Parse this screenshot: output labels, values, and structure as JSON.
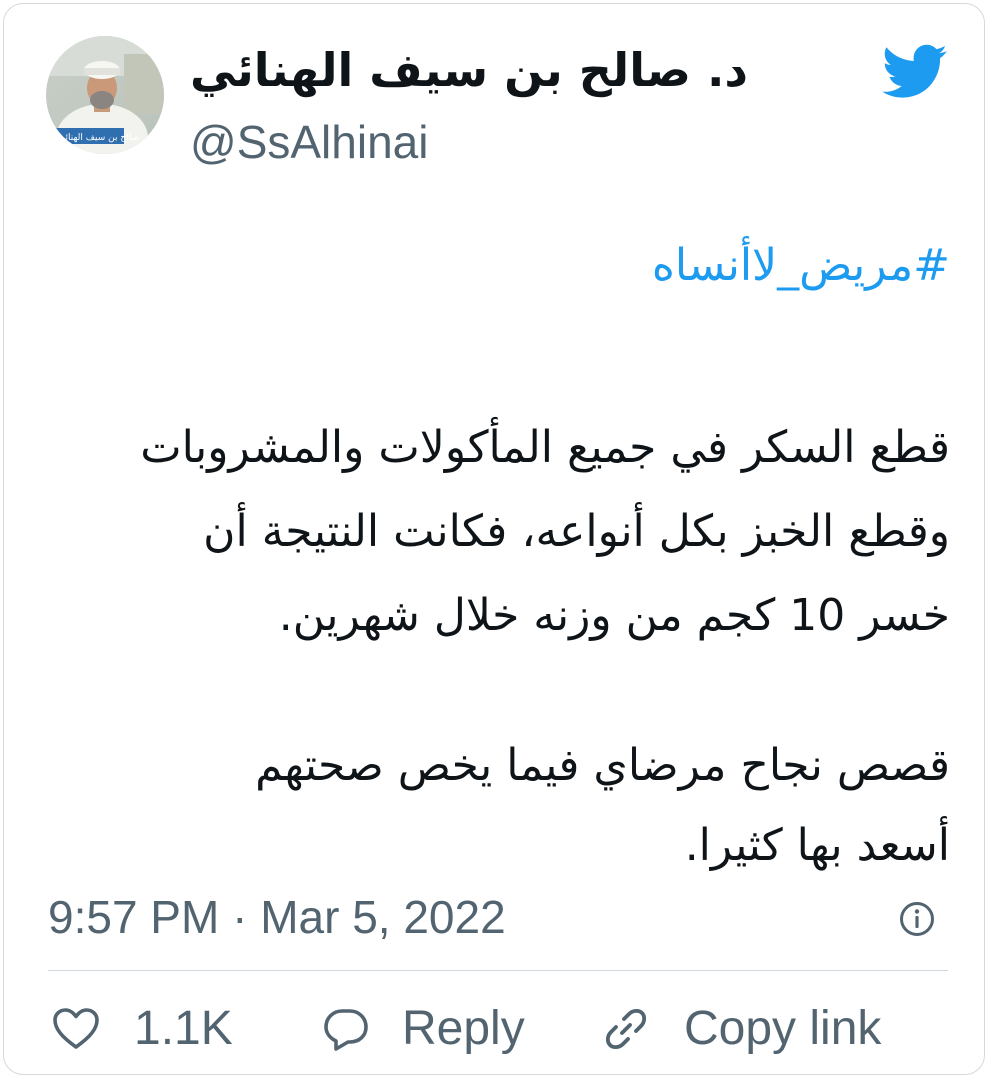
{
  "tweet": {
    "display_name": "د. صالح بن سيف الهنائي",
    "handle": "@SsAlhinai",
    "avatar_caption": "د. صالح بن سيف الهنائي",
    "hashtag": "#مريض_لاأنساه",
    "paragraph1": [
      "قطع السكر في جميع المأكولات والمشروبات",
      "وقطع الخبز بكل أنواعه، فكانت النتيجة أن",
      "خسر 10 كجم من وزنه خلال شهرين."
    ],
    "paragraph2": [
      "قصص نجاح مرضاي فيما يخص صحتهم",
      "أسعد بها كثيرا."
    ],
    "timestamp": "9:57 PM · Mar 5, 2022",
    "likes_count": "1.1K",
    "reply_label": "Reply",
    "copy_link_label": "Copy link"
  },
  "icons": {
    "brand": "twitter-bird-icon",
    "info": "info-icon",
    "like": "heart-icon",
    "reply": "speech-bubble-icon",
    "copy": "link-icon"
  },
  "colors": {
    "brand_blue": "#1d9bf0",
    "text_primary": "#0f1419",
    "text_secondary": "#536471",
    "border": "#cfd9de"
  }
}
